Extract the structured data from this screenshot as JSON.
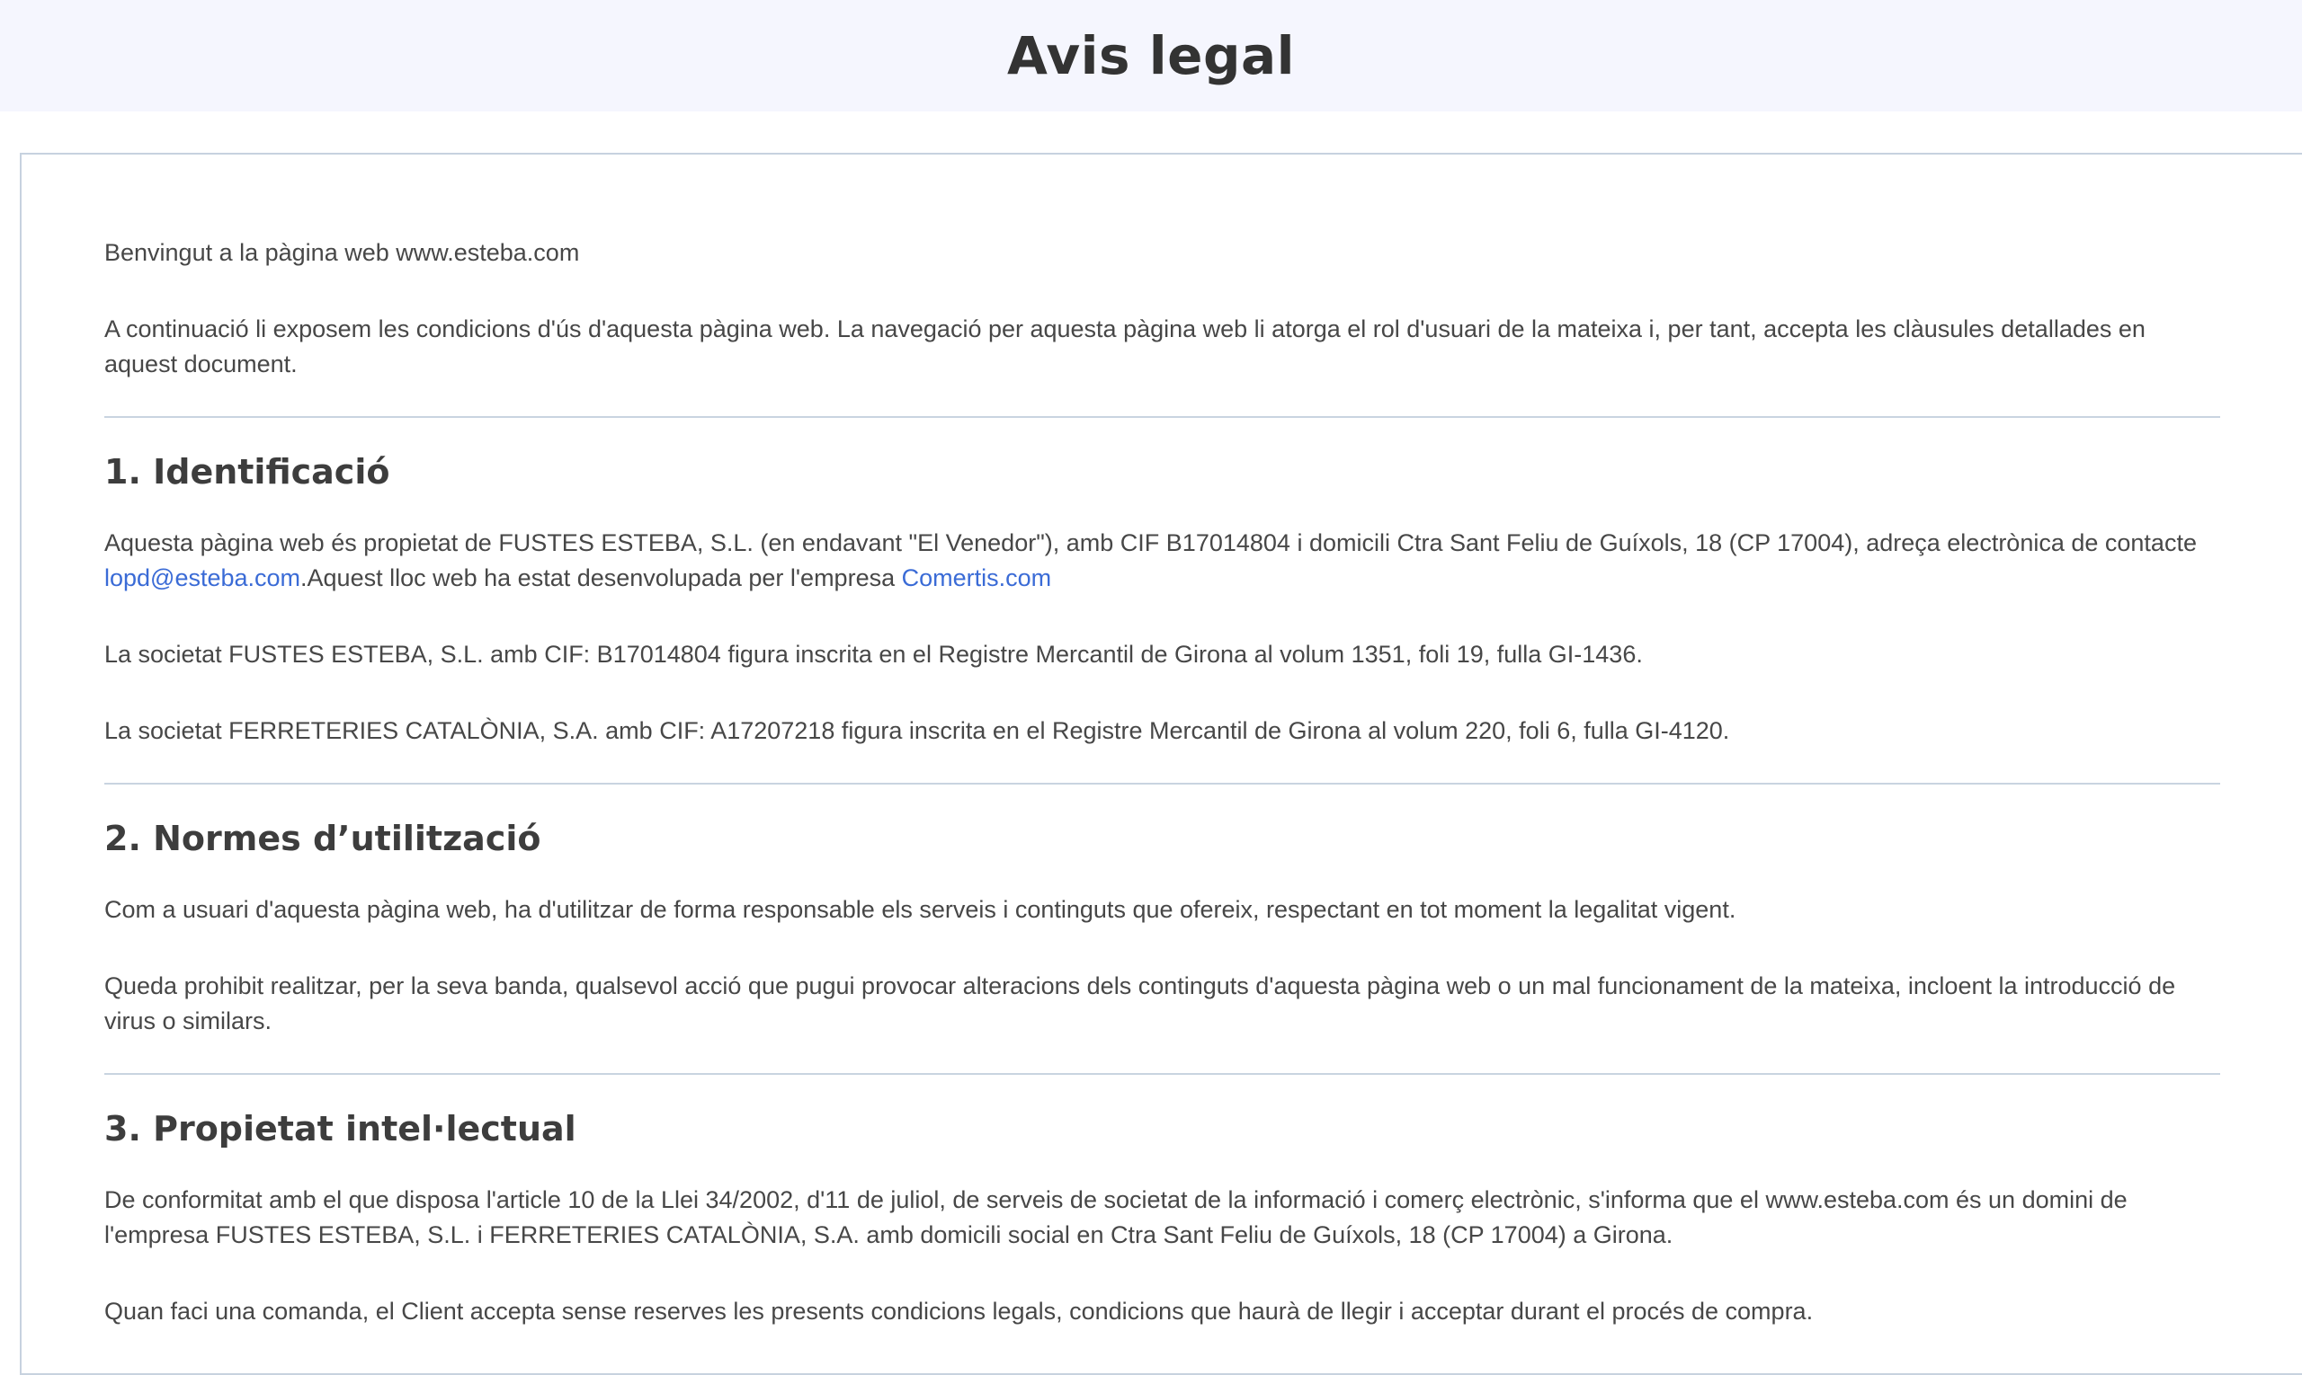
{
  "header": {
    "title": "Avis legal"
  },
  "intro": {
    "welcome": "Benvingut a la pàgina web www.esteba.com",
    "conditions": "A continuació li exposem les condicions d'ús d'aquesta pàgina web. La navegació per aquesta pàgina web li atorga el rol d'usuari de la mateixa i, per tant, accepta les clàusules detallades en aquest document."
  },
  "section1": {
    "title": "1. Identificació",
    "p1_before_email": "Aquesta pàgina web és propietat de FUSTES ESTEBA, S.L. (en endavant \"El Venedor\"), amb CIF B17014804 i domicili Ctra Sant Feliu de Guíxols, 18 (CP 17004), adreça electrònica de contacte ",
    "email_link": "lopd@esteba.com",
    "p1_middle": ".Aquest lloc web ha estat desenvolupada per l'empresa ",
    "developer_link": "Comertis.com",
    "p2": "La societat  FUSTES ESTEBA, S.L. amb CIF: B17014804 figura inscrita en el Registre Mercantil de Girona al volum 1351, foli 19, fulla GI-1436.",
    "p3": "La societat FERRETERIES CATALÒNIA, S.A. amb CIF: A17207218 figura inscrita en el Registre Mercantil de Girona al volum 220, foli 6, fulla GI-4120."
  },
  "section2": {
    "title": "2. Normes d’utilització",
    "p1": "Com a usuari d'aquesta pàgina web, ha d'utilitzar de forma responsable els serveis i continguts que ofereix, respectant en tot moment la legalitat vigent.",
    "p2": "Queda prohibit realitzar, per la seva banda, qualsevol acció que pugui provocar alteracions dels continguts d'aquesta pàgina web o un mal funcionament de la mateixa, incloent la introducció de virus o similars."
  },
  "section3": {
    "title": "3. Propietat intel·lectual",
    "p1": "De conformitat amb el que disposa l'article 10 de la Llei 34/2002, d'11 de juliol, de serveis de societat de la informació i comerç electrònic, s'informa que el www.esteba.com és un domini de l'empresa FUSTES ESTEBA, S.L. i FERRETERIES CATALÒNIA, S.A. amb domicili social en Ctra Sant Feliu de Guíxols, 18 (CP 17004) a Girona.",
    "p2": "Quan faci una comanda, el Client accepta sense reserves les presents condicions legals, condicions que haurà de llegir i acceptar durant el procés de compra."
  }
}
